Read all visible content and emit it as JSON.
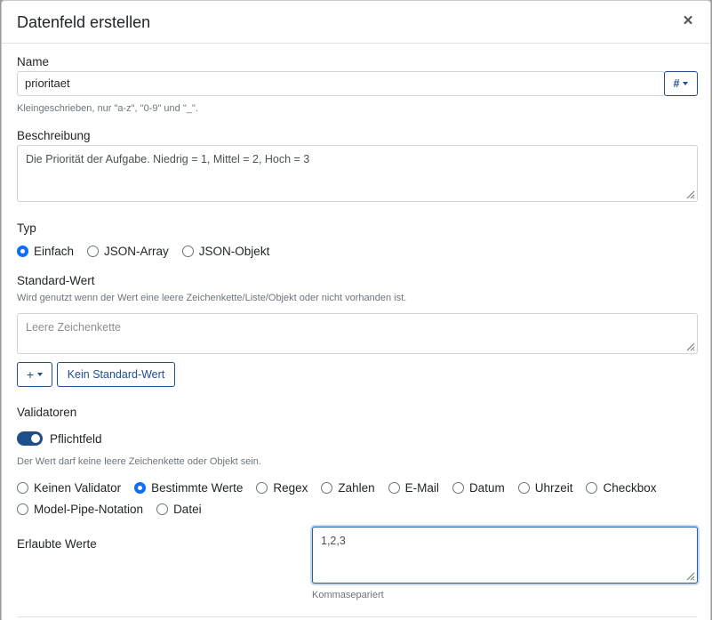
{
  "modal": {
    "title": "Datenfeld erstellen",
    "close": "×"
  },
  "name": {
    "label": "Name",
    "value": "prioritaet",
    "type_button": "#",
    "help": "Kleingeschrieben, nur \"a-z\", \"0-9\" und \"_\"."
  },
  "description": {
    "label": "Beschreibung",
    "value": "Die Priorität der Aufgabe. Niedrig = 1, Mittel = 2, Hoch = 3"
  },
  "type": {
    "label": "Typ",
    "options": [
      "Einfach",
      "JSON-Array",
      "JSON-Objekt"
    ],
    "selected": "Einfach"
  },
  "default_value": {
    "label": "Standard-Wert",
    "help": "Wird genutzt wenn der Wert eine leere Zeichenkette/Liste/Objekt oder nicht vorhanden ist.",
    "placeholder": "Leere Zeichenkette",
    "add_button": "+",
    "no_default_button": "Kein Standard-Wert"
  },
  "validators": {
    "label": "Validatoren",
    "required_label": "Pflichtfeld",
    "required_on": true,
    "required_help": "Der Wert darf keine leere Zeichenkette oder Objekt sein.",
    "options_row1": [
      "Keinen Validator",
      "Bestimmte Werte",
      "Regex",
      "Zahlen",
      "E-Mail",
      "Datum",
      "Uhrzeit",
      "Checkbox"
    ],
    "options_row2": [
      "Model-Pipe-Notation",
      "Datei"
    ],
    "selected": "Bestimmte Werte"
  },
  "allowed_values": {
    "label": "Erlaubte Werte",
    "value": "1,2,3",
    "help": "Kommasepariert"
  }
}
